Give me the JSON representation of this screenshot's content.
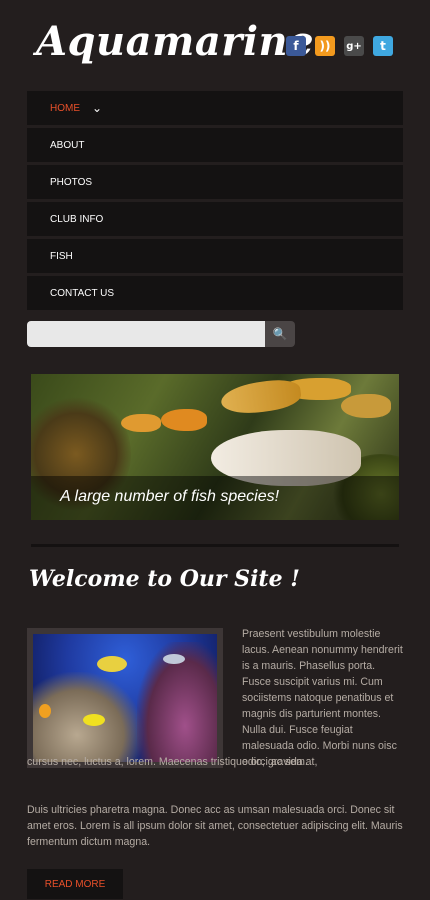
{
  "header": {
    "logo": "Aquamarine",
    "social": [
      {
        "icon": "facebook-icon",
        "glyph": "f"
      },
      {
        "icon": "rss-icon",
        "glyph": "))"
      },
      {
        "icon": "google-plus-icon",
        "glyph": "g+"
      },
      {
        "icon": "twitter-icon",
        "glyph": "t"
      }
    ]
  },
  "nav": {
    "items": [
      {
        "label": "HOME",
        "active": true
      },
      {
        "label": "ABOUT"
      },
      {
        "label": "PHOTOS"
      },
      {
        "label": "CLUB INFO"
      },
      {
        "label": "FISH"
      },
      {
        "label": "CONTACT US"
      }
    ]
  },
  "search": {
    "placeholder": "",
    "value": ""
  },
  "slider": {
    "caption": "A large number of fish species!"
  },
  "main": {
    "heading": "Welcome to Our Site !",
    "para1": "Praesent vestibulum molestie lacus. Aenean nonummy hendrerit is a mauris. Phasellus porta. Fusce suscipit varius mi. Cum sociistems natoque penatibus et magnis dis parturient montes. Nulla dui. Fusce feugiat malesuada odio. Morbi nuns oisc odio, gravida at,",
    "para1_cont": "cursus nec, luctus a, lorem. Maecenas tristique orci ac sem.",
    "para2": "Duis ultricies pharetra magna. Donec acc as umsan malesuada orci. Donec sit amet eros. Lorem is all ipsum dolor sit amet, consectetuer adipiscing elit. Mauris fermentum dictum magna.",
    "read_more": "READ MORE"
  },
  "colors": {
    "background": "#231e1e",
    "accent": "#e8502a",
    "nav_bg": "#141212"
  }
}
